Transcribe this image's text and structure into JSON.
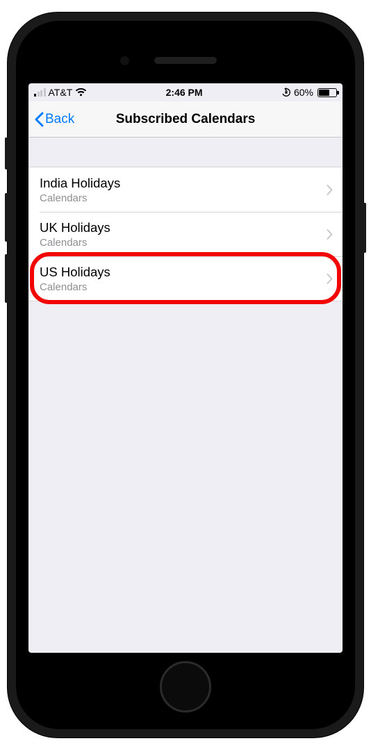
{
  "status_bar": {
    "carrier": "AT&T",
    "time": "2:46 PM",
    "battery_percent": "60%"
  },
  "nav": {
    "back_label": "Back",
    "title": "Subscribed Calendars"
  },
  "calendars": [
    {
      "title": "India Holidays",
      "subtitle": "Calendars",
      "highlighted": false
    },
    {
      "title": "UK Holidays",
      "subtitle": "Calendars",
      "highlighted": false
    },
    {
      "title": "US Holidays",
      "subtitle": "Calendars",
      "highlighted": true
    }
  ],
  "colors": {
    "ios_blue": "#007aff",
    "highlight_red": "#f20505",
    "bg_grouped": "#efeef4",
    "separator": "#d5d4d9",
    "secondary_text": "#8e8e93"
  }
}
